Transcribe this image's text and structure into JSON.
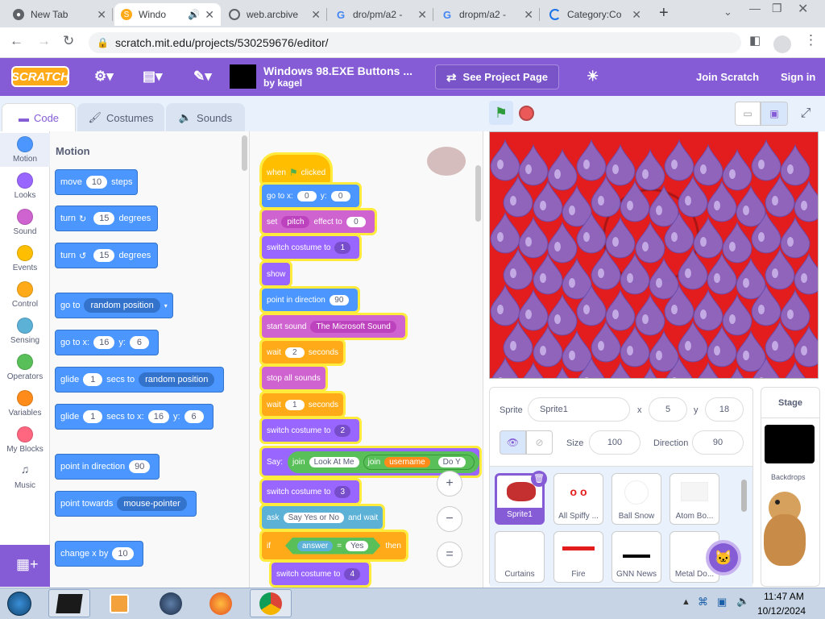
{
  "browser": {
    "tabs": [
      {
        "label": "New Tab",
        "icon": "chrome-icon"
      },
      {
        "label": "Windo",
        "icon": "scratch-icon",
        "active": true
      },
      {
        "label": "web.arcbive",
        "icon": "globe-icon"
      },
      {
        "label": "dro/pm/a2 -",
        "icon": "google-icon"
      },
      {
        "label": "dropm/a2 -",
        "icon": "google-icon"
      },
      {
        "label": "Category:Co",
        "icon": "loading-icon"
      }
    ],
    "new_tab": "+",
    "url": "scratch.mit.edu/projects/530259676/editor/"
  },
  "menu": {
    "logo": "SCRATCH",
    "project_title": "Windows 98.EXE Buttons ...",
    "project_author": "by kagel",
    "see_project": "See Project Page",
    "join": "Join Scratch",
    "signin": "Sign in"
  },
  "editor_tabs": {
    "code": "Code",
    "costumes": "Costumes",
    "sounds": "Sounds"
  },
  "categories": [
    {
      "label": "Motion",
      "color": "#4c97ff"
    },
    {
      "label": "Looks",
      "color": "#9966ff"
    },
    {
      "label": "Sound",
      "color": "#cf63cf"
    },
    {
      "label": "Events",
      "color": "#ffbf00"
    },
    {
      "label": "Control",
      "color": "#ffab19"
    },
    {
      "label": "Sensing",
      "color": "#5cb1d6"
    },
    {
      "label": "Operators",
      "color": "#59c059"
    },
    {
      "label": "Variables",
      "color": "#ff8c1a"
    },
    {
      "label": "My Blocks",
      "color": "#ff6680"
    },
    {
      "label": "Music",
      "color": "#0fbd8c"
    }
  ],
  "palette": {
    "title": "Motion",
    "move": {
      "a": "move",
      "v": "10",
      "b": "steps"
    },
    "turn_right": {
      "a": "turn",
      "v": "15",
      "b": "degrees"
    },
    "turn_left": {
      "a": "turn",
      "v": "15",
      "b": "degrees"
    },
    "goto": {
      "a": "go to",
      "v": "random position"
    },
    "goto_xy": {
      "a": "go to x:",
      "x": "16",
      "b": "y:",
      "y": "6"
    },
    "glide1": {
      "a": "glide",
      "v": "1",
      "b": "secs to",
      "c": "random position"
    },
    "glide2": {
      "a": "glide",
      "v": "1",
      "b": "secs to x:",
      "x": "16",
      "c": "y:",
      "y": "6"
    },
    "point_dir": {
      "a": "point in direction",
      "v": "90"
    },
    "point_towards": {
      "a": "point towards",
      "v": "mouse-pointer"
    },
    "change_x": {
      "a": "change x by",
      "v": "10"
    }
  },
  "script": {
    "hat": {
      "a": "when",
      "b": "clicked"
    },
    "goto": {
      "a": "go to x:",
      "x": "0",
      "b": "y:",
      "y": "0"
    },
    "set_effect": {
      "a": "set",
      "d": "pitch",
      "b": "effect to",
      "v": "0"
    },
    "switch1": {
      "a": "switch costume to",
      "v": "1"
    },
    "show": "show",
    "point": {
      "a": "point in direction",
      "v": "90"
    },
    "start_sound": {
      "a": "start sound",
      "v": "The Microsoft Sound"
    },
    "wait1": {
      "a": "wait",
      "v": "2",
      "b": "seconds"
    },
    "stop_sounds": "stop all sounds",
    "wait2": {
      "a": "wait",
      "v": "1",
      "b": "seconds"
    },
    "switch2": {
      "a": "switch costume to",
      "v": "2"
    },
    "say": {
      "a": "Say:",
      "j1": "join",
      "s1": "Look At Me",
      "j2": "join",
      "var": "username",
      "s2": "Do Y"
    },
    "switch3": {
      "a": "switch costume to",
      "v": "3"
    },
    "ask": {
      "a": "ask",
      "v": "Say Yes or No",
      "b": "and wait"
    },
    "if": {
      "a": "if",
      "var": "answer",
      "op": "=",
      "v": "Yes",
      "b": "then"
    },
    "switch4": {
      "a": "switch costume to",
      "v": "4"
    },
    "zoom_in": "+",
    "zoom_out": "−",
    "reset": "="
  },
  "sprite_info": {
    "sprite_label": "Sprite",
    "sprite_name": "Sprite1",
    "x_label": "x",
    "x": "5",
    "y_label": "y",
    "y": "18",
    "size_label": "Size",
    "size": "100",
    "dir_label": "Direction",
    "direction": "90"
  },
  "sprites": [
    "Sprite1",
    "All Spiffy ...",
    "Ball Snow",
    "Atom Bo...",
    "Curtains",
    "Fire",
    "GNN News",
    "Metal Do..."
  ],
  "stage_panel": {
    "title": "Stage",
    "backdrops": "Backdrops"
  },
  "taskbar": {
    "time": "11:47 AM",
    "date": "10/12/2024"
  },
  "colors": {
    "scratch_purple": "#855cd6",
    "motion": "#4c97ff",
    "looks": "#9966ff",
    "sound": "#cf63cf",
    "events": "#ffbf00",
    "control": "#ffab19",
    "stage_red": "#e31d1d"
  }
}
